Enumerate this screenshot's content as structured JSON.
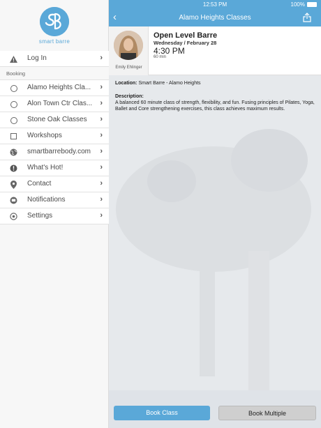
{
  "brand": {
    "name": "smart barre",
    "accent": "#5aa8d8"
  },
  "sidebar": {
    "login": "Log In",
    "section": "Booking",
    "items": [
      {
        "label": "Alamo Heights Cla...",
        "icon": "circle-icon"
      },
      {
        "label": "Alon Town Ctr Clas...",
        "icon": "circle-icon"
      },
      {
        "label": "Stone Oak Classes",
        "icon": "circle-icon"
      },
      {
        "label": "Workshops",
        "icon": "square-icon"
      },
      {
        "label": "smartbarrebody.com",
        "icon": "globe-icon"
      },
      {
        "label": "What's Hot!",
        "icon": "exclamation-icon"
      },
      {
        "label": "Contact",
        "icon": "location-pin-icon"
      },
      {
        "label": "Notifications",
        "icon": "message-icon"
      },
      {
        "label": "Settings",
        "icon": "gear-icon"
      }
    ]
  },
  "status": {
    "time": "12:53 PM",
    "battery": "100%"
  },
  "nav": {
    "title": "Alamo Heights Classes"
  },
  "class": {
    "name": "Open Level Barre",
    "date": "Wednesday / February 28",
    "time": "4:30 PM",
    "duration": "60 min",
    "instructor": "Emily Ehlinger",
    "location_label": "Location:",
    "location": "Smart Barre - Alamo Heights",
    "description_label": "Description:",
    "description": "A balanced 60 minute class of strength, flexibility, and fun. Fusing principles of Pilates, Yoga, Ballet and Core strengthening exercises, this class achieves maximum results."
  },
  "buttons": {
    "book": "Book Class",
    "multiple": "Book Multiple"
  }
}
